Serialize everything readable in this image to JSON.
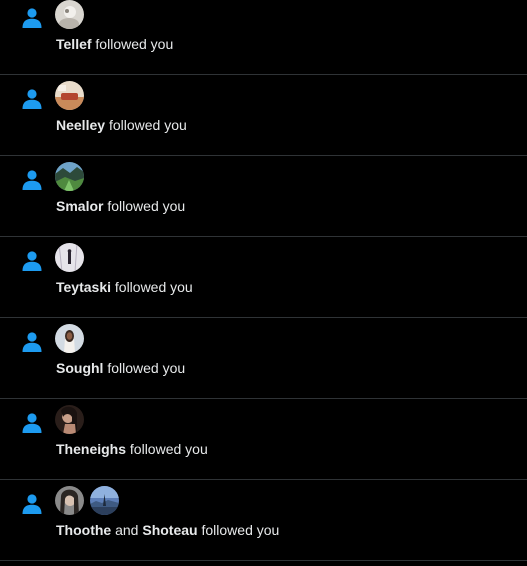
{
  "accent_color": "#1d9bf0",
  "notifications": [
    {
      "icon": "person-icon",
      "avatars": [
        "avatar-tellef"
      ],
      "names": [
        "Tellef"
      ],
      "action": "followed you"
    },
    {
      "icon": "person-icon",
      "avatars": [
        "avatar-neelley"
      ],
      "names": [
        "Neelley"
      ],
      "action": "followed you"
    },
    {
      "icon": "person-icon",
      "avatars": [
        "avatar-smalor"
      ],
      "names": [
        "Smalor"
      ],
      "action": "followed you"
    },
    {
      "icon": "person-icon",
      "avatars": [
        "avatar-teytaski"
      ],
      "names": [
        "Teytaski"
      ],
      "action": "followed you"
    },
    {
      "icon": "person-icon",
      "avatars": [
        "avatar-soughl"
      ],
      "names": [
        "Soughl"
      ],
      "action": "followed you"
    },
    {
      "icon": "person-icon",
      "avatars": [
        "avatar-theneighs"
      ],
      "names": [
        "Theneighs"
      ],
      "action": "followed you"
    },
    {
      "icon": "person-icon",
      "avatars": [
        "avatar-thoothe",
        "avatar-shoteau"
      ],
      "names": [
        "Thoothe",
        "Shoteau"
      ],
      "conjunction": "and",
      "action": "followed you"
    }
  ]
}
